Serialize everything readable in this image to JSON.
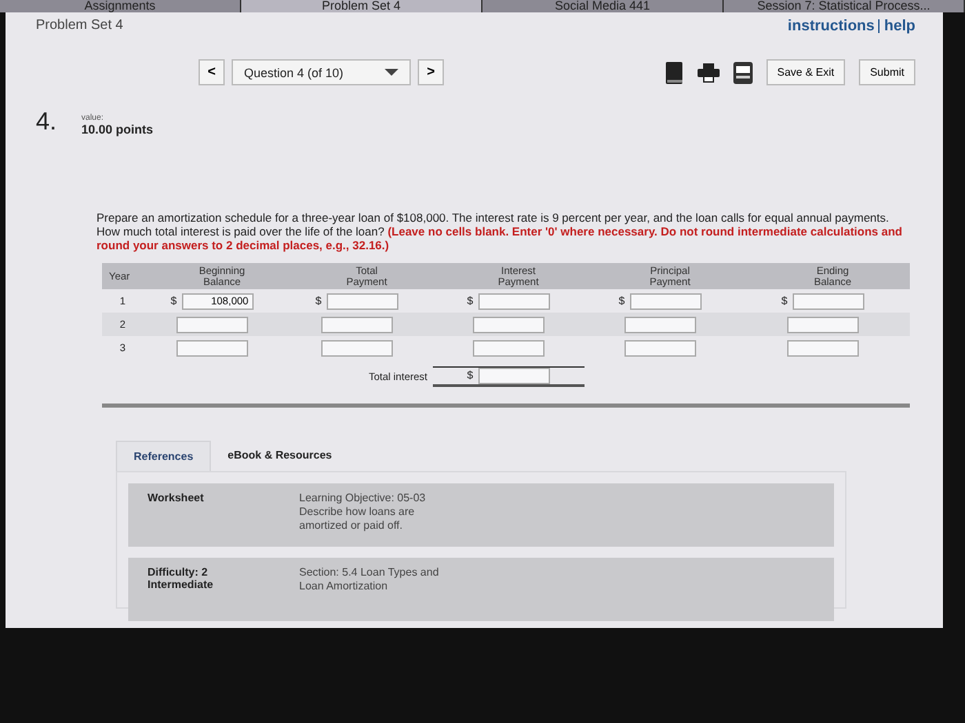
{
  "browser_tabs": [
    {
      "label": "Assignments",
      "selected": false
    },
    {
      "label": "Problem Set 4",
      "selected": true
    },
    {
      "label": "Social Media 441",
      "selected": false
    },
    {
      "label": "Session 7: Statistical Process...",
      "selected": false
    }
  ],
  "header": {
    "title": "Problem Set 4",
    "links": [
      "instructions",
      "help"
    ]
  },
  "nav": {
    "prev": "<",
    "question": "Question 4 (of 10)",
    "next": ">",
    "buttons": [
      "Save & Exit",
      "Submit"
    ]
  },
  "question": {
    "number": "4.",
    "value_label": "value:",
    "points": "10.00 points",
    "prompt": "Prepare an amortization schedule for a three-year loan of $108,000. The interest rate is 9 percent per year, and the loan calls for equal annual payments. How much total interest is paid over the life of the loan? **(Leave no cells blank. Enter '0' where necessary. Do not round intermediate calculations and round your answers to 2 decimal places, e.g., 32.16.)**"
  },
  "table": {
    "columns": [
      "Year",
      "Beginning Balance",
      "Total Payment",
      "Interest Payment",
      "Principal Payment",
      "Ending Balance"
    ],
    "rows": [
      {
        "cells": [
          {
            "text": "1"
          },
          {
            "prefix": "$",
            "value": "108,000"
          },
          {
            "prefix": "$"
          },
          {
            "prefix": "$"
          },
          {
            "prefix": "$"
          },
          {
            "prefix": "$"
          }
        ]
      },
      {
        "cells": [
          {
            "text": "2"
          },
          {},
          {},
          {},
          {},
          {}
        ]
      },
      {
        "cells": [
          {
            "text": "3"
          },
          {},
          {},
          {},
          {},
          {}
        ]
      }
    ],
    "total": {
      "label": "Total interest",
      "prefix": "$"
    }
  },
  "references": {
    "tabs": [
      {
        "label": "References",
        "selected": true
      },
      {
        "label": "eBook & Resources",
        "selected": false
      }
    ],
    "items": [
      {
        "title": "Worksheet",
        "text": "Learning Objective: 05-03 Describe how loans are amortized or paid off."
      },
      {
        "title": "Difficulty: 2 Intermediate",
        "text": "Section: 5.4 Loan Types and Loan Amortization"
      }
    ]
  }
}
